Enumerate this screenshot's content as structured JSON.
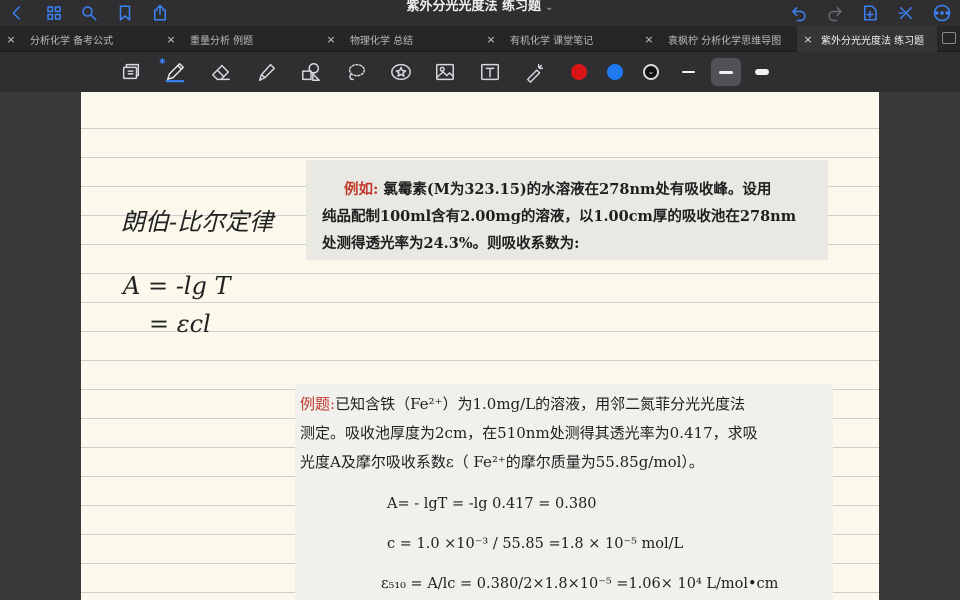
{
  "titlebar": {
    "title": "紫外分光光度法 练习题",
    "caret": "⌄",
    "left_icons": [
      "chevron-left-icon",
      "grid-icon",
      "search-icon",
      "bookmark-icon",
      "share-icon"
    ],
    "right_icons": [
      "undo-icon",
      "redo-icon",
      "add-page-icon",
      "close-icon",
      "more-icon"
    ]
  },
  "tabs": [
    {
      "label": "分析化学 备考公式",
      "active": false
    },
    {
      "label": "重量分析 例题",
      "active": false
    },
    {
      "label": "物理化学 总结",
      "active": false
    },
    {
      "label": "有机化学 课堂笔记",
      "active": false
    },
    {
      "label": "袁枫柠 分析化学思维导图",
      "active": false
    },
    {
      "label": "紫外分光光度法 练习题",
      "active": true
    }
  ],
  "tab_close": "×",
  "toolbar": {
    "tools": [
      "sidebar-toggle-icon",
      "pen-icon",
      "eraser-icon",
      "highlighter-icon",
      "shapes-icon",
      "lasso-icon",
      "sticker-icon",
      "image-icon",
      "text-icon",
      "laser-pointer-icon"
    ],
    "colors": [
      "#d81414",
      "#1e7cf0",
      "#111111"
    ],
    "more_colors_glyph": "⌄",
    "stroke_widths": [
      "thin",
      "medium",
      "thick"
    ],
    "selected_stroke": "medium"
  },
  "note": {
    "handwriting": {
      "title": "朗伯-比尔定律",
      "line1": "A = -lg T",
      "line2": "= εcl"
    },
    "example1": {
      "label": "例如:",
      "line1": "氯霉素(M为323.15)的水溶液在278nm处有吸收峰。设用",
      "line2": "纯品配制100ml含有2.00mg的溶液，以1.00cm厚的吸收池在278nm",
      "line3": "处测得透光率为24.3%。则吸收系数为:"
    },
    "example2": {
      "label": "例题:",
      "line1": "已知含铁（Fe²⁺）为1.0mg/L的溶液，用邻二氮菲分光光度法",
      "line2": "测定。吸收池厚度为2cm，在510nm处测得其透光率为0.417，求吸",
      "line3": "光度A及摩尔吸收系数ε（ Fe²⁺的摩尔质量为55.85g/mol）。",
      "eq1": "A= - lgT = -lg 0.417 = 0.380",
      "eq2": "c = 1.0 ×10⁻³ / 55.85 =1.8 × 10⁻⁵ mol/L",
      "eq3": "ε₅₁₀ = A/lc = 0.380/2×1.8×10⁻⁵ =1.06× 10⁴ L/mol•cm"
    }
  }
}
